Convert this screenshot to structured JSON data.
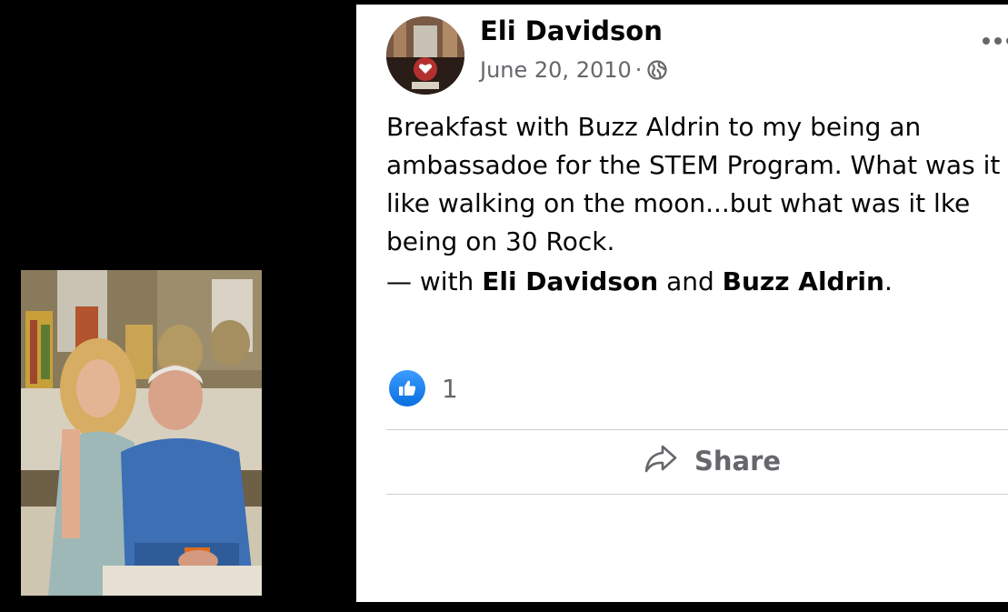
{
  "post": {
    "author": "Eli Davidson",
    "date": "June 20, 2010",
    "separator": "·",
    "audience_icon": "globe-icon",
    "text": "Breakfast with Buzz Aldrin to my being an ambassadoe for the STEM Program. What was it like walking on the moon...but what was it lke being on 30 Rock.",
    "tags": {
      "prefix": "— with",
      "person1": "Eli Davidson",
      "conjunction": "and",
      "person2": "Buzz Aldrin",
      "suffix": "."
    },
    "reactions": {
      "icon": "like-icon",
      "count": "1"
    },
    "actions": {
      "share_label": "Share"
    },
    "more_icon": "more-options-icon"
  },
  "colors": {
    "background": "#000000",
    "panel": "#ffffff",
    "text_primary": "#050505",
    "text_secondary": "#65676b",
    "like_blue": "#1877f2",
    "divider": "#ced0d4"
  }
}
